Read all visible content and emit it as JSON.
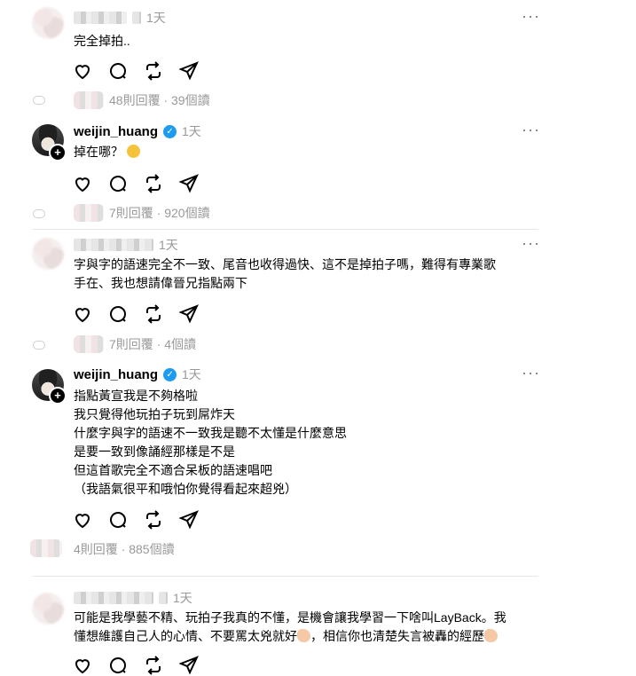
{
  "icons": [
    "heart-icon",
    "comment-icon",
    "repost-icon",
    "share-icon",
    "more-icon",
    "verified-icon",
    "follow-plus-icon"
  ],
  "colors": {
    "verified": "#1d9bf0",
    "muted": "#999999"
  },
  "posts": [
    {
      "username": "",
      "time": "1天",
      "body": "完全掉拍..",
      "stats": "48則回覆 · 39個讀"
    },
    {
      "username": "weijin_huang",
      "verified": true,
      "time": "1天",
      "body": "掉在哪？",
      "stats": "7則回覆 · 920個讀"
    },
    {
      "username": "",
      "time": "1天",
      "body": "字與字的語速完全不一致、尾音也收得過快、這不是掉拍子嗎，難得有專業歌\n手在、我也想請偉晉兄指點兩下",
      "stats": "7則回覆 · 4個讀"
    },
    {
      "username": "weijin_huang",
      "verified": true,
      "time": "1天",
      "body": "指點黃宣我是不夠格啦\n我只覺得他玩拍子玩到屌炸天\n什麼字與字的語速不一致我是聽不太懂是什麼意思\n是要一致到像誦經那樣是不是\n但這首歌完全不適合呆板的語速唱吧\n（我語氣很平和哦怕你覺得看起來超兇）",
      "stats": "4則回覆 · 885個讀"
    },
    {
      "username": "",
      "time": "1天",
      "body_line1": "可能是我學藝不精、玩拍子我真的不懂，是機會讓我學習一下啥叫LayBack。我",
      "body_line2a": "懂想維護自己人的心情、不要罵太兇就好",
      "body_line2b": "，相信你也清楚失言被轟的經歷"
    }
  ]
}
